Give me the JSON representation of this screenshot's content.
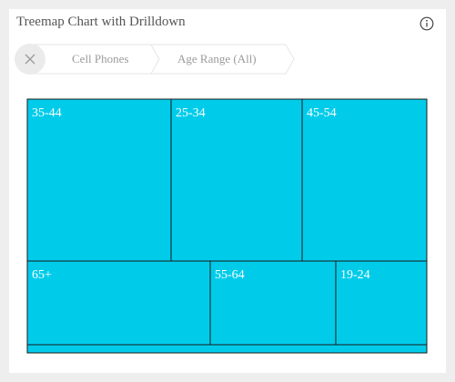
{
  "header": {
    "title": "Treemap Chart with Drilldown",
    "info_icon": "info-circle-icon"
  },
  "breadcrumbs": {
    "close_icon": "close-icon",
    "items": [
      "Cell Phones",
      "Age Range (All)"
    ]
  },
  "colors": {
    "tile_fill": "#00ccea",
    "tile_stroke": "#1a1a1a",
    "tile_label": "#ffffff"
  },
  "chart_data": {
    "type": "treemap",
    "tiles": [
      {
        "label": "35-44",
        "value": 14.0
      },
      {
        "label": "25-34",
        "value": 12.7
      },
      {
        "label": "45-54",
        "value": 12.1
      },
      {
        "label": "65+",
        "value": 9.2
      },
      {
        "label": "55-64",
        "value": 6.3
      },
      {
        "label": "19-24",
        "value": 4.6
      },
      {
        "label": "",
        "value": 1.9
      }
    ]
  }
}
